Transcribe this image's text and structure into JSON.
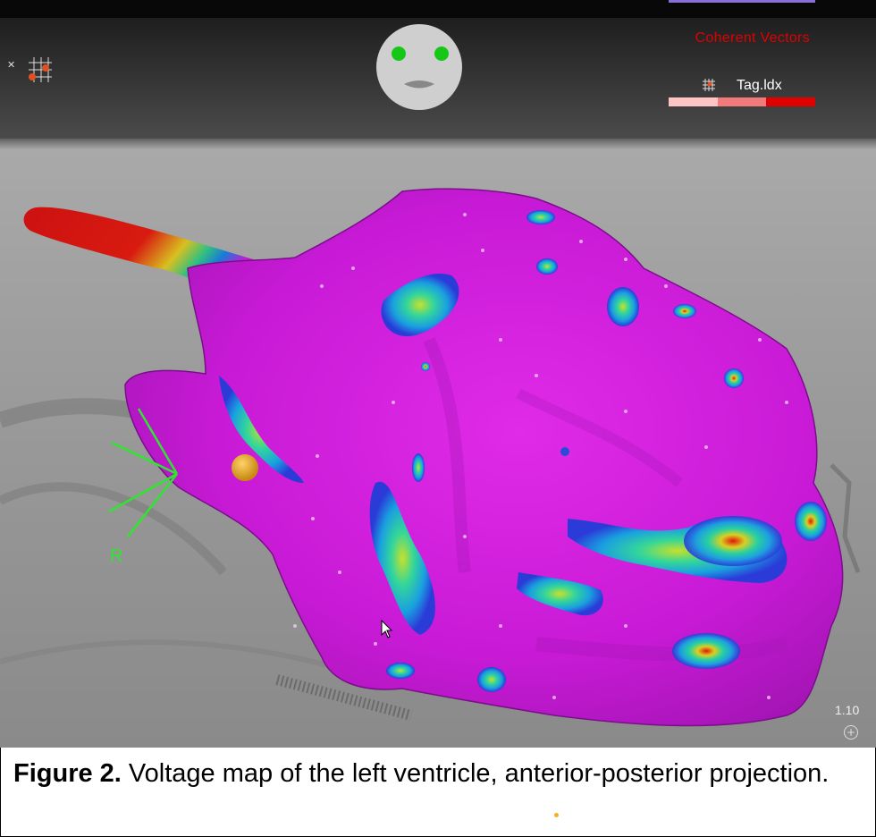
{
  "hud": {
    "legend_title": "Coherent Vectors",
    "tag_label": "Tag.ldx",
    "tag_scale_colors": [
      "#ffc4c4",
      "#f27a7a",
      "#e00000"
    ],
    "zoom_level": "1.10",
    "orientation_label": "R"
  },
  "caption": {
    "label": "Figure 2.",
    "text": " Voltage map of the left ventricle, anterior-posterior projection."
  },
  "colors": {
    "healthy_tissue": "#d21fe0",
    "scar_low_voltage": "#e4140e",
    "border_zone": "#1fb0e0",
    "orientation_marker": "#2ee62e",
    "catheter_tip": "#e8a21a"
  }
}
